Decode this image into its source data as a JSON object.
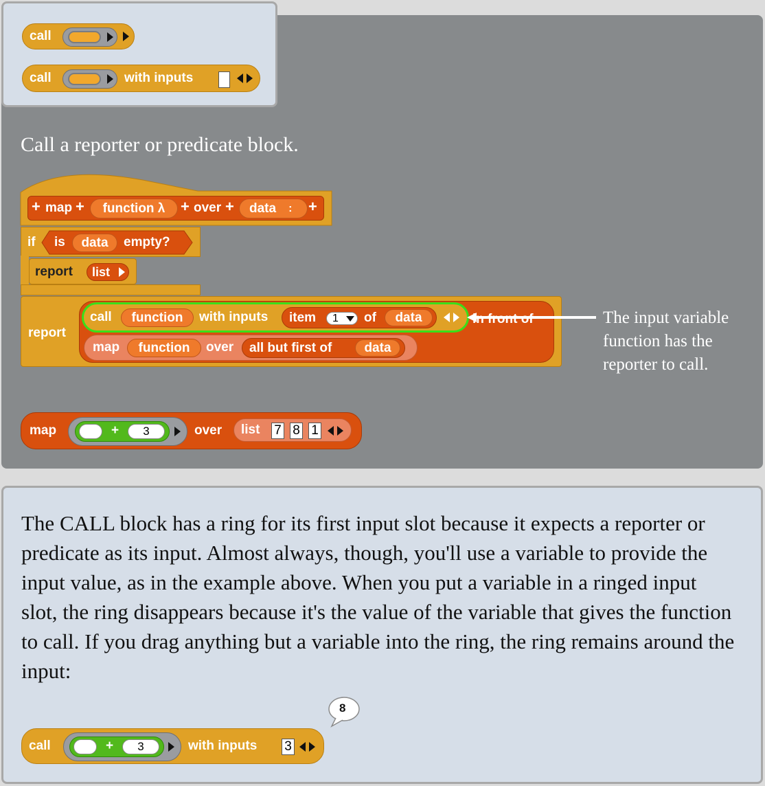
{
  "palette": {
    "call": "call",
    "with_inputs": "with inputs"
  },
  "caption": "Call a reporter or predicate block.",
  "script": {
    "hat": {
      "map": "map",
      "function": "function λ",
      "over": "over",
      "data": "data",
      "colon": ":"
    },
    "if_block": {
      "if": "if",
      "is": "is",
      "data": "data",
      "empty": "empty?"
    },
    "report_list": {
      "report": "report",
      "list": "list"
    },
    "report2": {
      "report": "report",
      "call": "call",
      "function": "function",
      "with_inputs": "with inputs",
      "item": "item",
      "item_index": "1",
      "of": "of",
      "data": "data",
      "in_front_of": "in front of",
      "map": "map",
      "function2": "function",
      "over": "over",
      "all_but_first_of": "all but first of",
      "data2": "data"
    }
  },
  "annotation": "The input variable function has the reporter to call.",
  "map_example": {
    "map": "map",
    "plus": "+",
    "num": "3",
    "over": "over",
    "list": "list",
    "items": [
      "7",
      "8",
      "1"
    ]
  },
  "paragraph": "The CALL block has a ring for its first input slot because it expects a reporter or predicate as its input. Almost always, though, you'll use a variable to provide the input value, as in the example above. When you put a variable in a ringed input slot, the ring disappears because it's the value of the variable that gives the function to call. If you drag anything but a variable into the ring, the ring remains around the input:",
  "call_example": {
    "call": "call",
    "plus": "+",
    "num": "3",
    "with_inputs": "with inputs",
    "input": "3",
    "result": "8"
  },
  "colors": {
    "control": "#e0a126",
    "variables": "#d9500e",
    "lists": "#ea8460",
    "operators": "#52b91c",
    "highlight": "#38e01a"
  }
}
